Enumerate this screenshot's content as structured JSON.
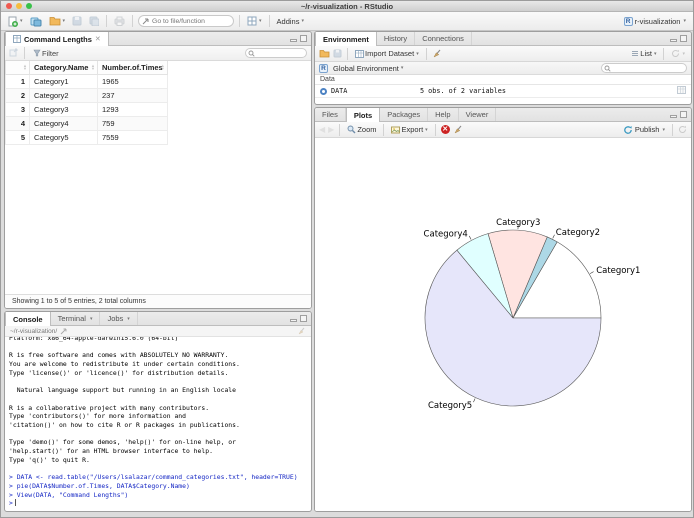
{
  "window": {
    "title": "~/r-visualization - RStudio"
  },
  "main_toolbar": {
    "goto_placeholder": "Go to file/function",
    "addins_label": "Addins",
    "project_label": "r-visualization"
  },
  "data_viewer": {
    "tab_title": "Command Lengths",
    "filter_label": "Filter",
    "table": {
      "columns": [
        "Category.Name",
        "Number.of.Times"
      ],
      "rows": [
        {
          "num": "1",
          "name": "Category1",
          "times": "1965"
        },
        {
          "num": "2",
          "name": "Category2",
          "times": "237"
        },
        {
          "num": "3",
          "name": "Category3",
          "times": "1293"
        },
        {
          "num": "4",
          "name": "Category4",
          "times": "759"
        },
        {
          "num": "5",
          "name": "Category5",
          "times": "7559"
        }
      ]
    },
    "footer": "Showing 1 to 5 of 5 entries, 2 total columns"
  },
  "console": {
    "tabs": [
      "Console",
      "Terminal",
      "Jobs"
    ],
    "path": "~/r-visualization/",
    "lines": [
      {
        "text": "Platform: x86_64-apple-darwin15.6.0 (64-bit)",
        "type": "output"
      },
      {
        "text": "",
        "type": "output"
      },
      {
        "text": "R is free software and comes with ABSOLUTELY NO WARRANTY.",
        "type": "output"
      },
      {
        "text": "You are welcome to redistribute it under certain conditions.",
        "type": "output"
      },
      {
        "text": "Type 'license()' or 'licence()' for distribution details.",
        "type": "output"
      },
      {
        "text": "",
        "type": "output"
      },
      {
        "text": "  Natural language support but running in an English locale",
        "type": "output"
      },
      {
        "text": "",
        "type": "output"
      },
      {
        "text": "R is a collaborative project with many contributors.",
        "type": "output"
      },
      {
        "text": "Type 'contributors()' for more information and",
        "type": "output"
      },
      {
        "text": "'citation()' on how to cite R or R packages in publications.",
        "type": "output"
      },
      {
        "text": "",
        "type": "output"
      },
      {
        "text": "Type 'demo()' for some demos, 'help()' for on-line help, or",
        "type": "output"
      },
      {
        "text": "'help.start()' for an HTML browser interface to help.",
        "type": "output"
      },
      {
        "text": "Type 'q()' to quit R.",
        "type": "output"
      },
      {
        "text": "",
        "type": "output"
      },
      {
        "text": "> DATA <- read.table(\"/Users/lsalazar/command_categories.txt\", header=TRUE)",
        "type": "input"
      },
      {
        "text": "> pie(DATA$Number.of.Times, DATA$Category.Name)",
        "type": "input"
      },
      {
        "text": "> View(DATA, \"Command Lengths\")",
        "type": "input"
      }
    ],
    "prompt": ">"
  },
  "environment": {
    "tabs": [
      "Environment",
      "History",
      "Connections"
    ],
    "toolbar": {
      "import_label": "Import Dataset",
      "list_label": "List"
    },
    "scope_label": "Global Environment",
    "section_label": "Data",
    "objects": [
      {
        "name": "DATA",
        "summary": "5 obs. of 2 variables"
      }
    ]
  },
  "plots": {
    "tabs": [
      "Files",
      "Plots",
      "Packages",
      "Help",
      "Viewer"
    ],
    "active_tab": "Plots",
    "toolbar": {
      "zoom_label": "Zoom",
      "export_label": "Export",
      "publish_label": "Publish"
    }
  },
  "chart_data": {
    "type": "pie",
    "categories": [
      "Category1",
      "Category2",
      "Category3",
      "Category4",
      "Category5"
    ],
    "values": [
      1965,
      237,
      1293,
      759,
      7559
    ],
    "colors": [
      "#FFFFFF",
      "#ADD8E6",
      "#FFE4E1",
      "#E0FFFF",
      "#E6E6FA"
    ],
    "start_angle_deg": 0,
    "direction": "counterclockwise",
    "title": "",
    "legend": "none",
    "label_source": "categories"
  }
}
